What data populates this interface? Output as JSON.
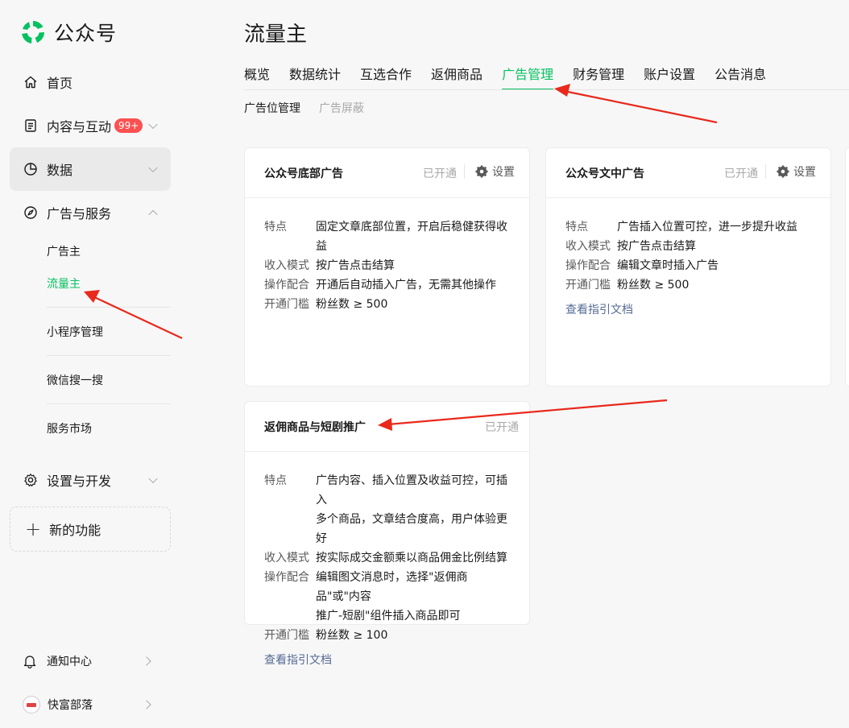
{
  "app": {
    "name": "公众号"
  },
  "sidebar": {
    "home": "首页",
    "content": "内容与互动",
    "content_badge": "99+",
    "data": "数据",
    "ads": "广告与服务",
    "ads_sub": [
      "广告主",
      "流量主",
      "小程序管理",
      "微信搜一搜",
      "服务市场"
    ],
    "settings": "设置与开发",
    "new_feature": "新的功能",
    "notifications": "通知中心",
    "account": "快富部落"
  },
  "page": {
    "title": "流量主",
    "tabs": [
      "概览",
      "数据统计",
      "互选合作",
      "返佣商品",
      "广告管理",
      "财务管理",
      "账户设置",
      "公告消息"
    ],
    "active_tab": "广告管理",
    "subtabs": [
      "广告位管理",
      "广告屏蔽"
    ]
  },
  "cards": [
    {
      "title": "公众号底部广告",
      "status": "已开通",
      "settings": "设置",
      "rows": [
        {
          "k": "特点",
          "v": "固定文章底部位置，开启后稳健获得收益"
        },
        {
          "k": "收入模式",
          "v": "按广告点击结算"
        },
        {
          "k": "操作配合",
          "v": "开通后自动插入广告，无需其他操作"
        },
        {
          "k": "开通门槛",
          "v": "粉丝数 ≥ 500"
        }
      ]
    },
    {
      "title": "公众号文中广告",
      "status": "已开通",
      "settings": "设置",
      "rows": [
        {
          "k": "特点",
          "v": "广告插入位置可控，进一步提升收益"
        },
        {
          "k": "收入模式",
          "v": "按广告点击结算"
        },
        {
          "k": "操作配合",
          "v": "编辑文章时插入广告"
        },
        {
          "k": "开通门槛",
          "v": "粉丝数 ≥ 500"
        }
      ],
      "link": "查看指引文档"
    },
    {
      "title": "返佣商品与短剧推广",
      "status": "已开通",
      "rows": [
        {
          "k": "特点",
          "v": "广告内容、插入位置及收益可控，可插入",
          "v2": "多个商品，文章结合度高，用户体验更好"
        },
        {
          "k": "收入模式",
          "v": "按实际成交金额乘以商品佣金比例结算"
        },
        {
          "k": "操作配合",
          "v": "编辑图文消息时，选择\"返佣商品\"或\"内容",
          "v2": "推广-短剧\"组件插入商品即可"
        },
        {
          "k": "开通门槛",
          "v": "粉丝数 ≥ 100"
        }
      ],
      "link": "查看指引文档"
    }
  ],
  "colors": {
    "accent": "#07c160",
    "link": "#576b95",
    "badge": "#fa5151",
    "annotation_arrow": "#e8291c"
  },
  "icons": [
    "wechat-logo",
    "home-icon",
    "document-icon",
    "pie-chart-icon",
    "compass-icon",
    "gear-icon",
    "plus-icon",
    "bell-icon",
    "chevron-icon"
  ]
}
